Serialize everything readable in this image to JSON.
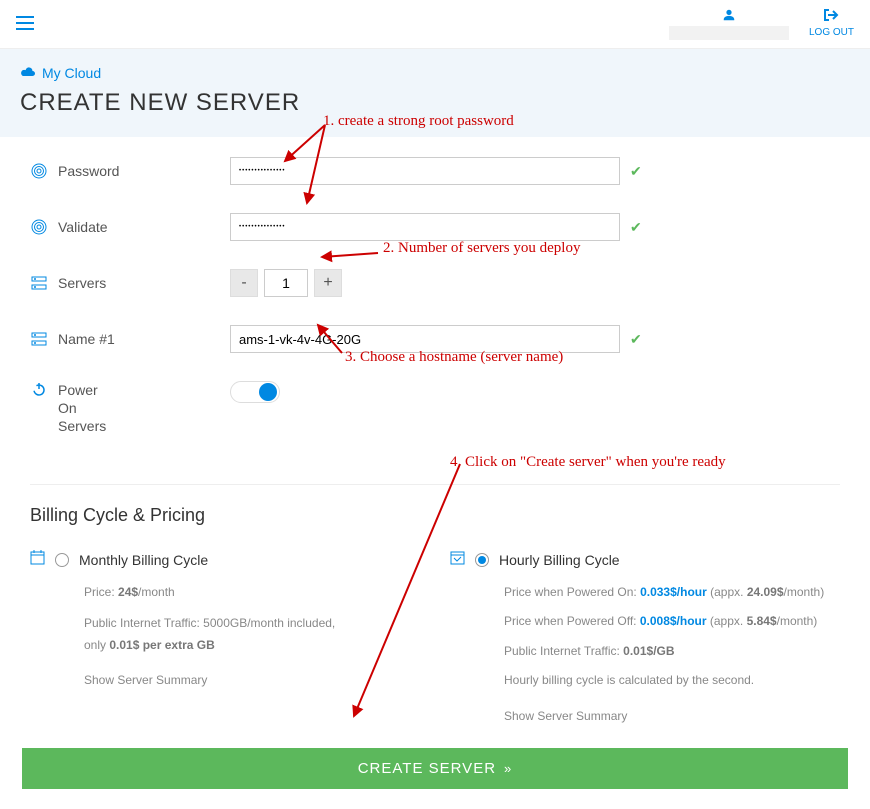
{
  "topbar": {
    "logout_label": "LOG OUT"
  },
  "header": {
    "breadcrumb_label": "My Cloud",
    "page_title": "CREATE NEW SERVER"
  },
  "form": {
    "password_label": "Password",
    "password_value": "●●●●●●●●●●●●●●●",
    "validate_label": "Validate",
    "validate_value": "●●●●●●●●●●●●●●●",
    "servers_label": "Servers",
    "servers_count": "1",
    "minus": "-",
    "plus": "+",
    "name_label": "Name #1",
    "name_value": "ams-1-vk-4v-4G-20G",
    "power_label_1": "Power",
    "power_label_2": "On",
    "power_label_3": "Servers"
  },
  "annotations": {
    "a1": "1. create a strong root password",
    "a2": "2. Number of servers you deploy",
    "a3": "3. Choose a hostname (server name)",
    "a4": "4. Click on \"Create server\" when you're ready"
  },
  "billing": {
    "section_title": "Billing Cycle & Pricing",
    "monthly": {
      "title": "Monthly Billing Cycle",
      "price_prefix": "Price: ",
      "price_value": "24$",
      "price_suffix": "/month",
      "traffic_line_a": "Public Internet Traffic: 5000GB/month included,",
      "traffic_line_b_pre": "only ",
      "traffic_line_b_bold": "0.01$ per extra GB",
      "summary": "Show Server Summary"
    },
    "hourly": {
      "title": "Hourly Billing Cycle",
      "on_prefix": "Price when Powered On: ",
      "on_price": "0.033$",
      "on_unit": "/hour",
      "on_appx_pre": " (appx. ",
      "on_appx_val": "24.09$",
      "on_appx_unit": "/month)",
      "off_prefix": "Price when Powered Off: ",
      "off_price": "0.008$",
      "off_unit": "/hour",
      "off_appx_pre": " (appx. ",
      "off_appx_val": "5.84$",
      "off_appx_unit": "/month)",
      "traffic_prefix": "Public Internet Traffic: ",
      "traffic_val": "0.01$/GB",
      "note": "Hourly billing cycle is calculated by the second.",
      "summary": "Show Server Summary"
    }
  },
  "cta": {
    "label": "CREATE SERVER"
  }
}
